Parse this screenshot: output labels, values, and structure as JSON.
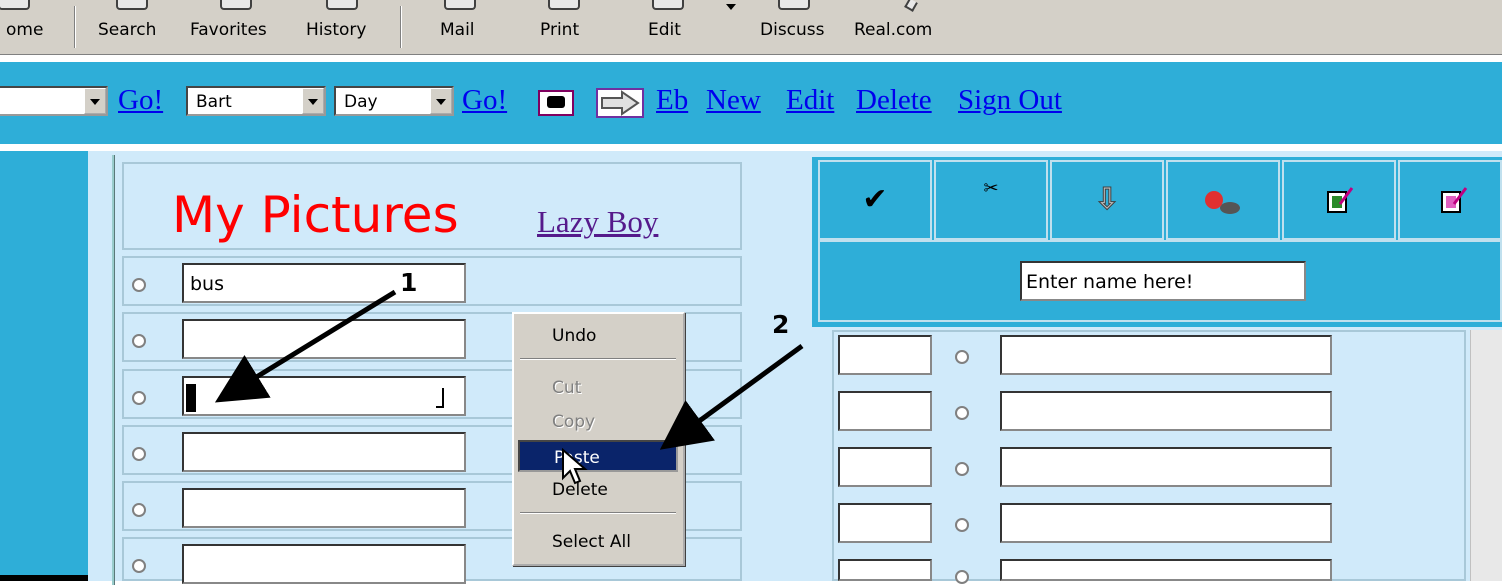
{
  "toolbar": {
    "items": [
      {
        "label": "ome"
      },
      {
        "label": "Search"
      },
      {
        "label": "Favorites"
      },
      {
        "label": "History"
      },
      {
        "label": "Mail"
      },
      {
        "label": "Print"
      },
      {
        "label": "Edit"
      },
      {
        "label": "Discuss"
      },
      {
        "label": "Real.com"
      }
    ]
  },
  "navbar": {
    "go1": "Go!",
    "person_select": "Bart",
    "period_select": "Day",
    "go2": "Go!",
    "links": [
      "Eb",
      "New",
      "Edit",
      "Delete",
      "Sign Out"
    ]
  },
  "pictures": {
    "title": "My Pictures",
    "link": "Lazy Boy",
    "rows": [
      "bus",
      "",
      "",
      "",
      "",
      ""
    ]
  },
  "context_menu": {
    "items": [
      {
        "label": "Undo",
        "state": "enabled"
      },
      {
        "label": "Cut",
        "state": "disabled"
      },
      {
        "label": "Copy",
        "state": "disabled"
      },
      {
        "label": "Paste",
        "state": "selected"
      },
      {
        "label": "Delete",
        "state": "enabled"
      },
      {
        "label": "Select All",
        "state": "enabled"
      }
    ]
  },
  "right_panel": {
    "icons": [
      "checkmark-icon",
      "scissors-icon",
      "down-arrow-icon",
      "pushpin-icon",
      "edit-document-icon",
      "edit-document-pink-icon"
    ],
    "name_placeholder": "Enter name here!"
  },
  "annotations": {
    "label1": "1",
    "label2": "2"
  },
  "colors": {
    "nav_blue": "#2eaed8",
    "panel_light": "#d0eafa",
    "title_red": "#ff0000",
    "menu_highlight": "#0a246a"
  }
}
